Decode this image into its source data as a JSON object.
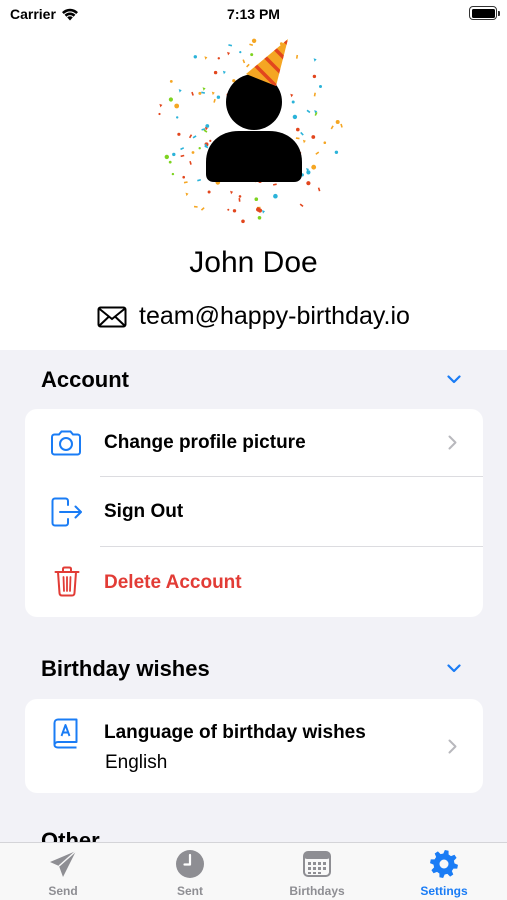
{
  "status_bar": {
    "carrier": "Carrier",
    "time": "7:13 PM"
  },
  "profile": {
    "name": "John Doe",
    "email": "team@happy-birthday.io"
  },
  "sections": {
    "account": {
      "title": "Account",
      "items": [
        {
          "label": "Change profile picture",
          "icon": "camera-icon"
        },
        {
          "label": "Sign Out",
          "icon": "sign-out-icon"
        },
        {
          "label": "Delete Account",
          "icon": "trash-icon"
        }
      ]
    },
    "birthday_wishes": {
      "title": "Birthday wishes",
      "items": [
        {
          "label": "Language of birthday wishes",
          "value": "English",
          "icon": "language-book-icon"
        }
      ]
    },
    "other": {
      "title": "Other"
    }
  },
  "tabs": [
    {
      "label": "Send",
      "icon": "paper-plane-icon"
    },
    {
      "label": "Sent",
      "icon": "clock-icon"
    },
    {
      "label": "Birthdays",
      "icon": "calendar-icon"
    },
    {
      "label": "Settings",
      "icon": "gear-icon",
      "active": true
    }
  ],
  "colors": {
    "accent": "#1a7cf5",
    "danger": "#e23c36",
    "grouped_background": "#f2f2f7",
    "party_hat": "#f5a623"
  }
}
